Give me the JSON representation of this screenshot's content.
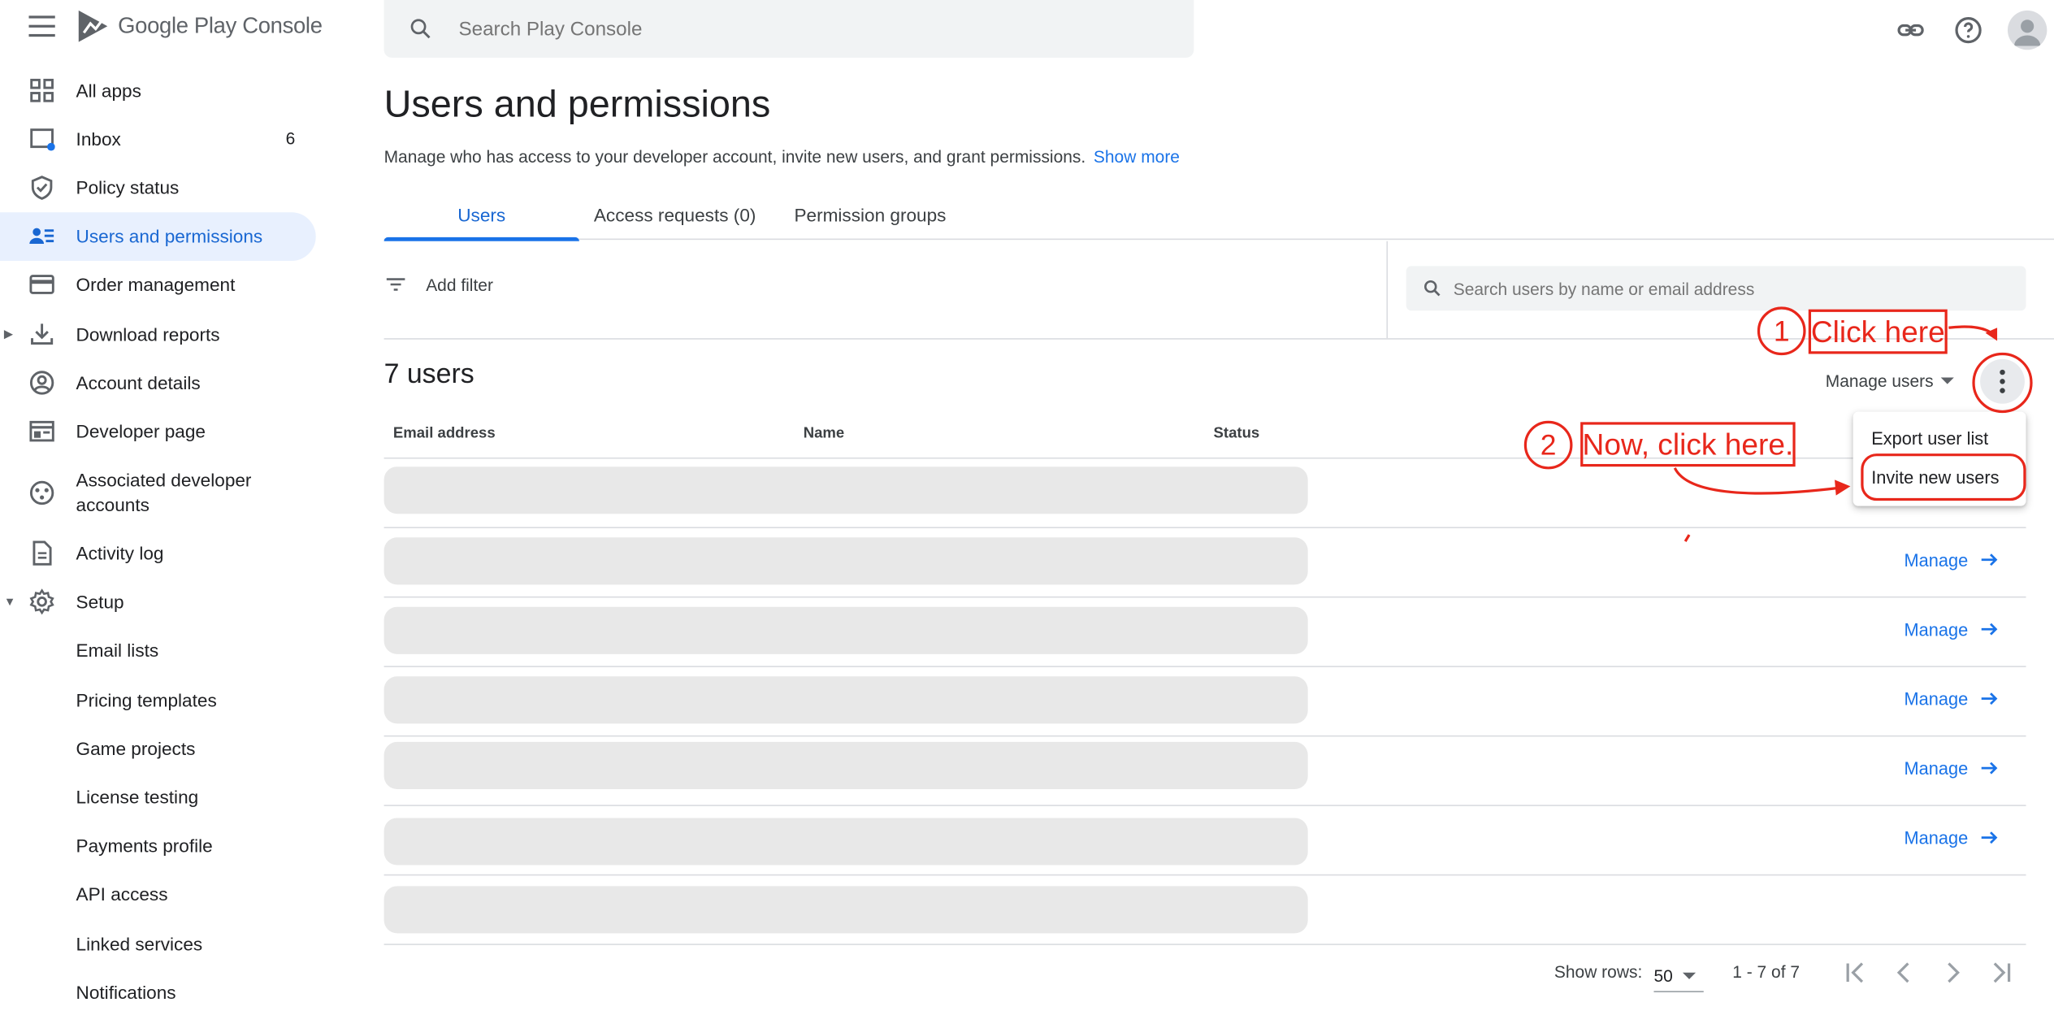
{
  "app": {
    "name": "Google Play Console"
  },
  "search": {
    "placeholder": "Search Play Console"
  },
  "sidebar": {
    "items": [
      {
        "label": "All apps",
        "icon": "grid-icon"
      },
      {
        "label": "Inbox",
        "icon": "inbox-icon",
        "badge": "6"
      },
      {
        "label": "Policy status",
        "icon": "shield-icon"
      },
      {
        "label": "Users and permissions",
        "icon": "users-icon",
        "active": true
      },
      {
        "label": "Order management",
        "icon": "credit-card-icon"
      },
      {
        "label": "Download reports",
        "icon": "download-icon"
      },
      {
        "label": "Account details",
        "icon": "account-circle-icon"
      },
      {
        "label": "Developer page",
        "icon": "web-page-icon"
      },
      {
        "label": "Associated developer accounts",
        "icon": "linked-accounts-icon"
      },
      {
        "label": "Activity log",
        "icon": "document-icon"
      },
      {
        "label": "Setup",
        "icon": "gear-icon"
      }
    ],
    "setup_subitems": [
      "Email lists",
      "Pricing templates",
      "Game projects",
      "License testing",
      "Payments profile",
      "API access",
      "Linked services",
      "Notifications"
    ]
  },
  "page": {
    "title": "Users and permissions",
    "subtitle": "Manage who has access to your developer account, invite new users, and grant permissions.",
    "show_more": "Show more"
  },
  "tabs": [
    "Users",
    "Access requests (0)",
    "Permission groups"
  ],
  "filter": {
    "add_filter": "Add filter",
    "search_placeholder": "Search users by name or email address"
  },
  "users": {
    "count_label": "7 users",
    "manage_users": "Manage users",
    "columns": [
      "Email address",
      "Name",
      "Status"
    ],
    "manage_link": "Manage",
    "rows_with_manage": [
      false,
      true,
      true,
      true,
      true,
      true,
      false
    ]
  },
  "menu": {
    "items": [
      "Export user list",
      "Invite new users"
    ]
  },
  "footer": {
    "show_rows_label": "Show rows:",
    "rows_value": "50",
    "range": "1 - 7 of 7"
  },
  "annotations": {
    "step1_number": "1",
    "step1_text": "Click here",
    "step2_number": "2",
    "step2_text": "Now, click here.",
    "color": "#e8271b"
  },
  "colors": {
    "accent": "#1a73e8",
    "active_bg": "#e8f0fe"
  }
}
